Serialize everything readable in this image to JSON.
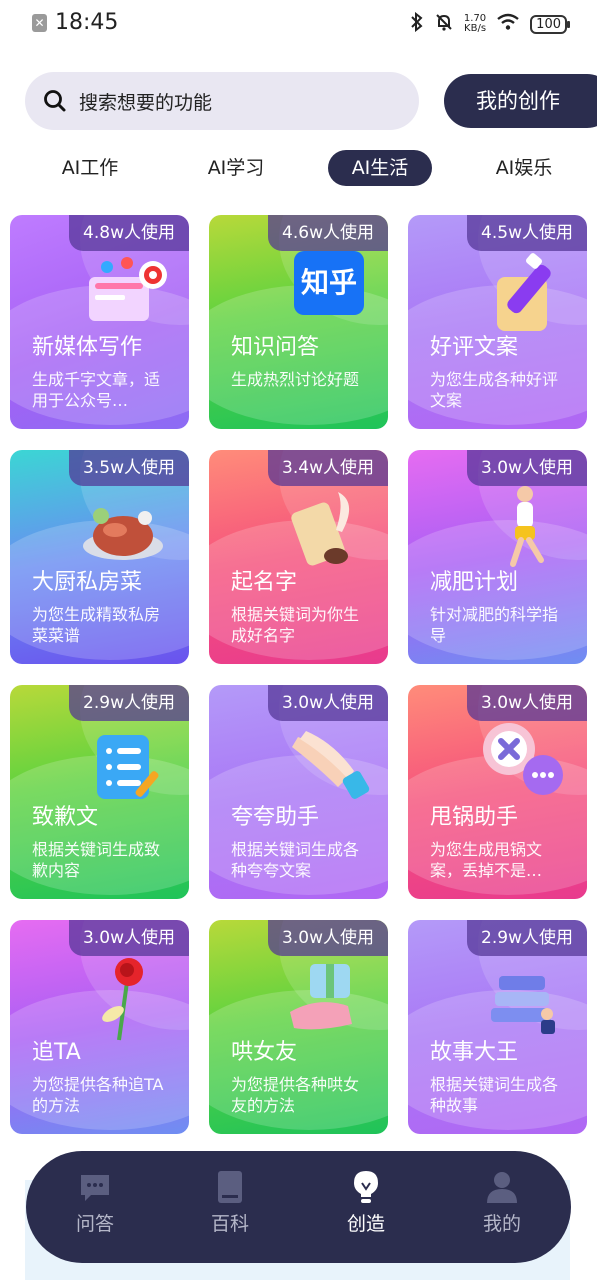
{
  "status_bar": {
    "time": "18:45",
    "net_speed": "1.70",
    "net_unit": "KB/s",
    "battery": "100"
  },
  "search": {
    "placeholder": "搜索想要的功能"
  },
  "header": {
    "my_create_label": "我的创作"
  },
  "tabs": [
    {
      "label": "AI工作",
      "active": false
    },
    {
      "label": "AI学习",
      "active": false
    },
    {
      "label": "AI生活",
      "active": true
    },
    {
      "label": "AI娱乐",
      "active": false
    }
  ],
  "cards": [
    {
      "title": "新媒体写作",
      "desc": "生成千字文章，适用于公众号…",
      "usage": "4.8w人使用",
      "icon": "social-media-icon"
    },
    {
      "title": "知识问答",
      "desc": "生成热烈讨论好题",
      "usage": "4.6w人使用",
      "icon": "zhihu-logo-icon",
      "icon_text": "知乎"
    },
    {
      "title": "好评文案",
      "desc": "为您生成各种好评文案",
      "usage": "4.5w人使用",
      "icon": "pen-icon"
    },
    {
      "title": "大厨私房菜",
      "desc": "为您生成精致私房菜菜谱",
      "usage": "3.5w人使用",
      "icon": "roast-chicken-icon"
    },
    {
      "title": "起名字",
      "desc": "根据关键词为你生成好名字",
      "usage": "3.4w人使用",
      "icon": "scroll-quill-icon"
    },
    {
      "title": "减肥计划",
      "desc": "针对减肥的科学指导",
      "usage": "3.0w人使用",
      "icon": "running-person-icon"
    },
    {
      "title": "致歉文",
      "desc": "根据关键词生成致歉内容",
      "usage": "2.9w人使用",
      "icon": "document-list-icon"
    },
    {
      "title": "夸夸助手",
      "desc": "根据关键词生成各种夸夸文案",
      "usage": "3.0w人使用",
      "icon": "clapping-hands-icon"
    },
    {
      "title": "甩锅助手",
      "desc": "为您生成甩锅文案，丢掉不是…",
      "usage": "3.0w人使用",
      "icon": "chat-bubble-x-icon"
    },
    {
      "title": "追TA",
      "desc": "为您提供各种追TA的方法",
      "usage": "3.0w人使用",
      "icon": "rose-icon"
    },
    {
      "title": "哄女友",
      "desc": "为您提供各种哄女友的方法",
      "usage": "3.0w人使用",
      "icon": "gift-hand-icon"
    },
    {
      "title": "故事大王",
      "desc": "根据关键词生成各种故事",
      "usage": "2.9w人使用",
      "icon": "books-reader-icon"
    }
  ],
  "bottom_nav": [
    {
      "label": "问答",
      "icon": "chat-icon",
      "active": false
    },
    {
      "label": "百科",
      "icon": "book-icon",
      "active": false
    },
    {
      "label": "创造",
      "icon": "lightbulb-icon",
      "active": true
    },
    {
      "label": "我的",
      "icon": "user-icon",
      "active": false
    }
  ]
}
